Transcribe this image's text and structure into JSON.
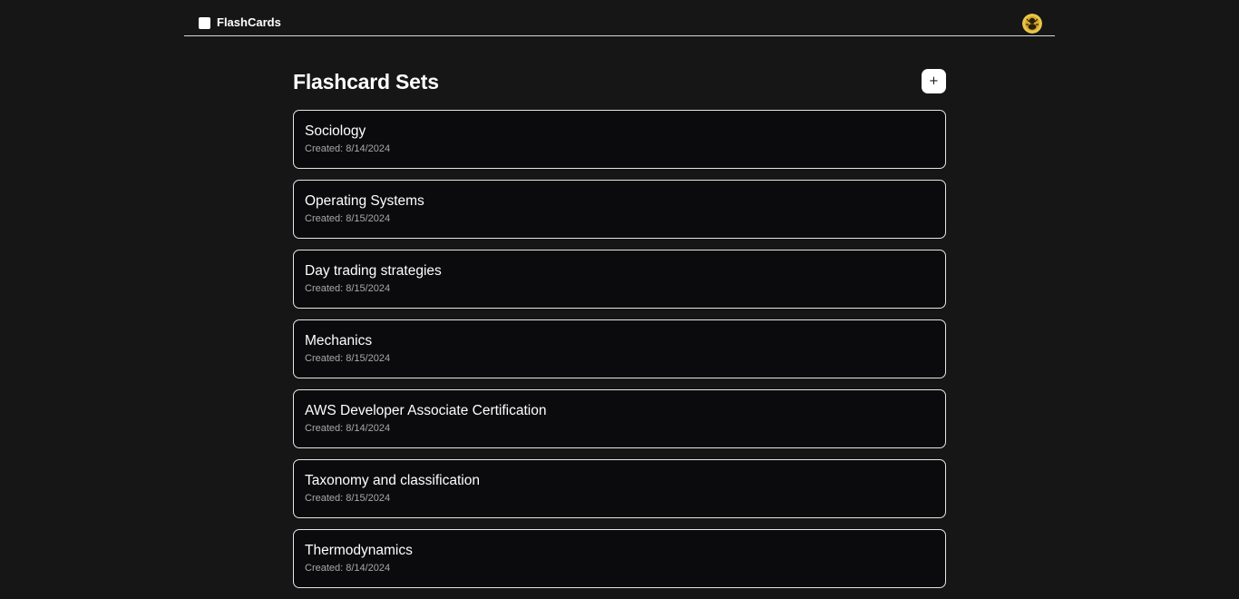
{
  "app": {
    "name": "FlashCards"
  },
  "main": {
    "title": "Flashcard Sets",
    "add_button_label": "+",
    "created_label": "Created:",
    "sets": [
      {
        "title": "Sociology",
        "created": "8/14/2024"
      },
      {
        "title": "Operating Systems",
        "created": "8/15/2024"
      },
      {
        "title": "Day trading strategies",
        "created": "8/15/2024"
      },
      {
        "title": "Mechanics",
        "created": "8/15/2024"
      },
      {
        "title": "AWS Developer Associate Certification",
        "created": "8/14/2024"
      },
      {
        "title": "Taxonomy and classification",
        "created": "8/15/2024"
      },
      {
        "title": "Thermodynamics",
        "created": "8/14/2024"
      }
    ]
  },
  "colors": {
    "background": "#161616",
    "card_background": "#0b0b0d",
    "card_border": "#e6e6e6",
    "muted_text": "#a8a8a8"
  },
  "icons": {
    "brand": "square-logo-icon",
    "add": "plus-icon",
    "avatar": "user-avatar"
  }
}
